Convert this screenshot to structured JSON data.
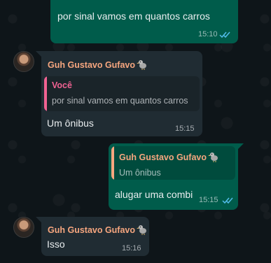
{
  "messages": [
    {
      "direction": "outgoing",
      "text": "por sinal vamos em quantos carros",
      "time": "15:10",
      "status": "read"
    },
    {
      "direction": "incoming",
      "sender": "Guh Gustavo Gufavo",
      "sender_emoji": "dodo-icon",
      "quote": {
        "author": "Você",
        "text": "por sinal vamos em quantos carros"
      },
      "text": "Um ônibus",
      "time": "15:15"
    },
    {
      "direction": "outgoing",
      "quote": {
        "author": "Guh Gustavo Gufavo",
        "text": "Um ônibus"
      },
      "text": "alugar uma combi",
      "time": "15:15",
      "status": "read"
    },
    {
      "direction": "incoming",
      "sender": "Guh Gustavo Gufavo",
      "sender_emoji": "dodo-icon",
      "text": "Isso",
      "time": "15:16"
    }
  ],
  "colors": {
    "outgoing_bubble": "#005c4b",
    "incoming_bubble": "#202c33",
    "sender_name": "#f6a67f",
    "quote_self_bar": "#f06292",
    "quote_other_bar": "#f6a67f",
    "read_ticks": "#53bdeb"
  }
}
